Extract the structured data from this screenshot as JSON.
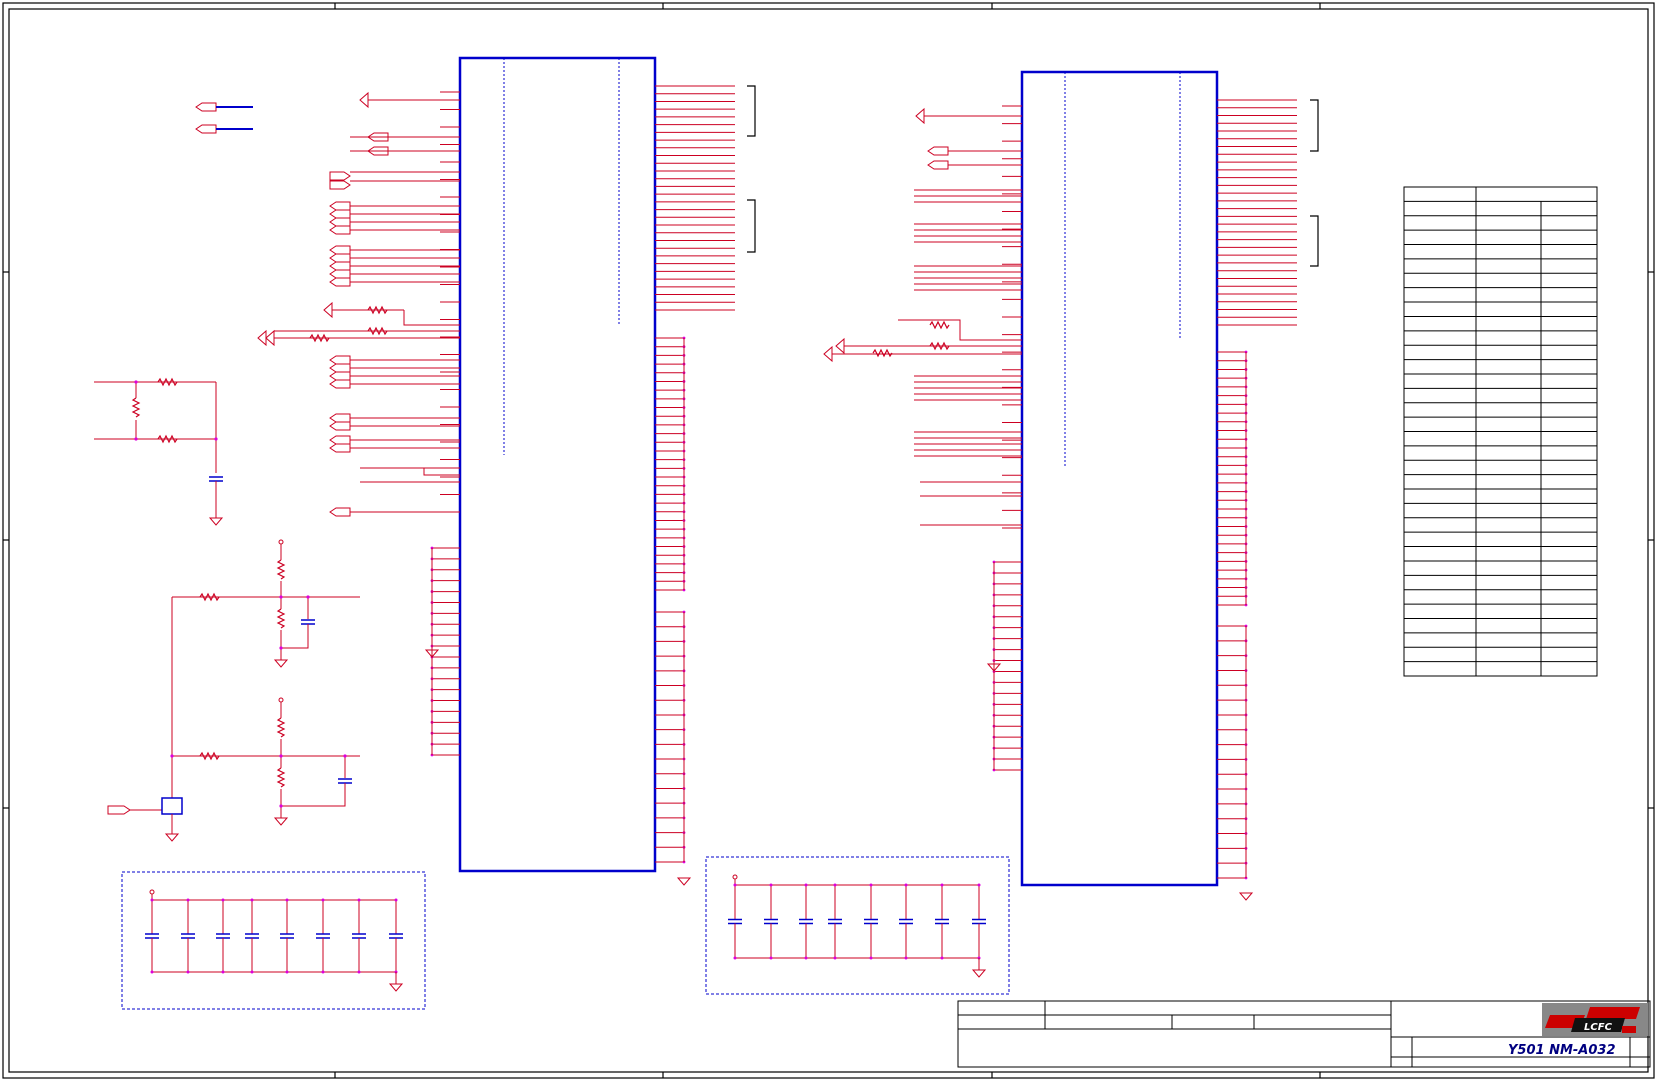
{
  "title_block": {
    "model_text": "Y501  NM-A032",
    "logo_text": "LCFC"
  },
  "colors": {
    "frame": "#000000",
    "wire": "#cc0022",
    "component": "#0000cc",
    "junction": "#dd00dd",
    "table": "#000000",
    "logo_bg": "#888888",
    "logo_red": "#cc0000",
    "logo_black": "#111111"
  },
  "connectors": {
    "left": {
      "left_pin_count": 45,
      "right_pin_count": 78
    },
    "right": {
      "left_pin_count": 45,
      "right_pin_count": 78
    }
  },
  "decoupling_groups": [
    {
      "capacitor_count": 8
    },
    {
      "capacitor_count": 8
    }
  ],
  "pin_table": {
    "rows": 34,
    "columns": 3
  }
}
